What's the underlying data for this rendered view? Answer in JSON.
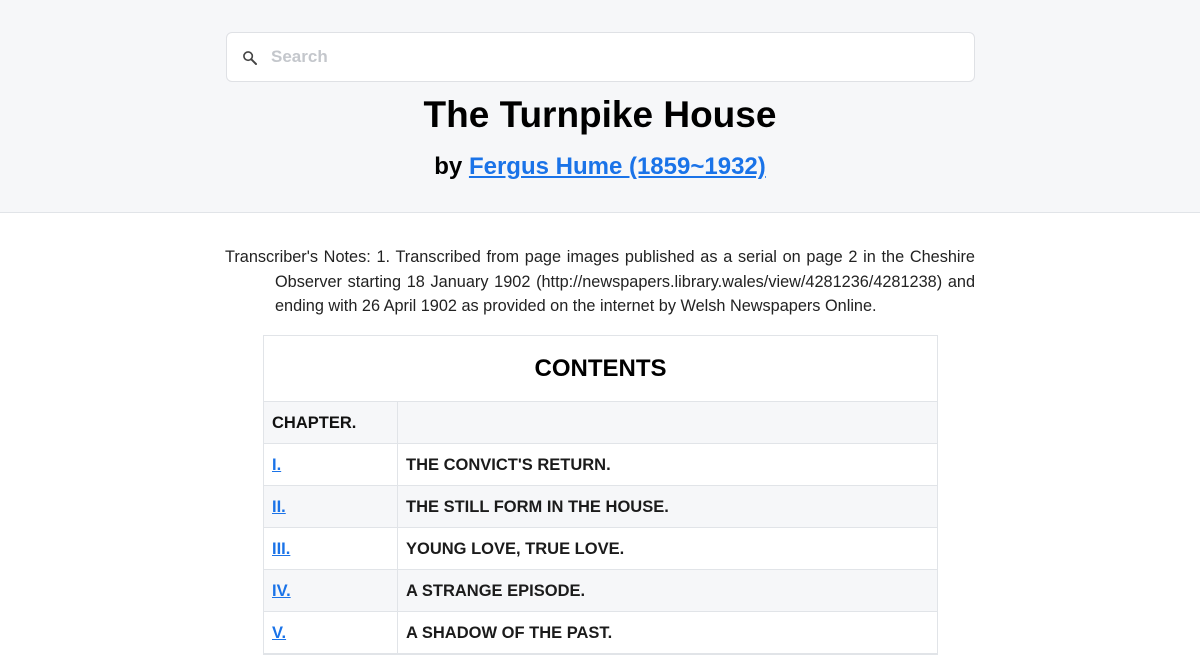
{
  "search": {
    "placeholder": "Search",
    "value": ""
  },
  "book": {
    "title": "The Turnpike House",
    "by_label": "by",
    "author": "Fergus Hume (1859~1932)"
  },
  "notes": {
    "text": "Transcriber's Notes: 1. Transcribed from page images published as a serial on page 2 in the Cheshire Observer starting 18 January 1902 (http://newspapers.library.wales/view/4281236/4281238) and ending with 26 April 1902 as provided on the internet by Welsh Newspapers Online."
  },
  "contents": {
    "heading": "CONTENTS",
    "column_header": "CHAPTER.",
    "chapters": [
      {
        "num": "I.",
        "title": "THE CONVICT'S RETURN."
      },
      {
        "num": "II.",
        "title": "THE STILL FORM IN THE HOUSE."
      },
      {
        "num": "III.",
        "title": "YOUNG LOVE, TRUE LOVE."
      },
      {
        "num": "IV.",
        "title": "A STRANGE EPISODE."
      },
      {
        "num": "V.",
        "title": "A SHADOW OF THE PAST."
      }
    ]
  },
  "colors": {
    "header_bg": "#f6f7f9",
    "link": "#1a73e8",
    "border": "#e1e4e8"
  }
}
